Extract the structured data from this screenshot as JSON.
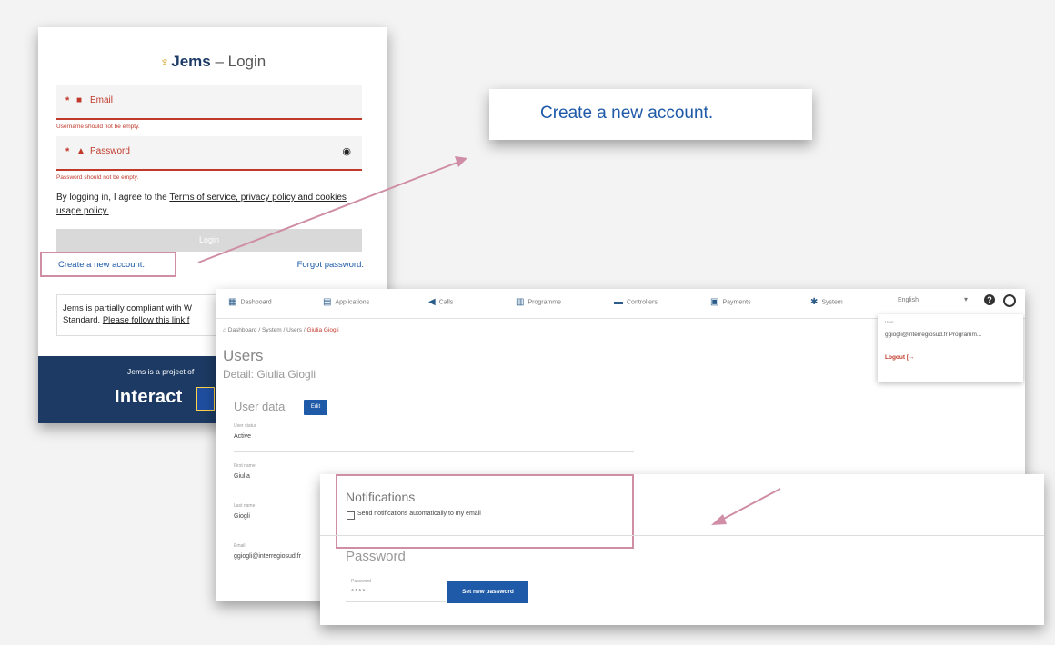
{
  "login": {
    "brand": "Jems",
    "title_suffix": " – Login",
    "email_label": "Email",
    "email_error": "Username should not be empty.",
    "password_label": "Password",
    "password_error": "Password should not be empty.",
    "agree_prefix": "By logging in, I agree to the ",
    "agree_link": "Terms of service, privacy policy and cookies usage policy.",
    "login_button": "Login",
    "create_account": "Create a new account.",
    "forgot_password": "Forgot password.",
    "compliance_line1": "Jems is partially compliant with W",
    "compliance_line2_prefix": "Standard. ",
    "compliance_link": "Please follow this link f",
    "footer_project": "Jems is a project of",
    "footer_brand": "Interact"
  },
  "zoom": {
    "text": "Create a new account."
  },
  "app": {
    "nav": [
      {
        "label": "Dashboard",
        "icon": "dashboard-icon",
        "glyph": "▦"
      },
      {
        "label": "Applications",
        "icon": "document-icon",
        "glyph": "▤"
      },
      {
        "label": "Calls",
        "icon": "megaphone-icon",
        "glyph": "◀"
      },
      {
        "label": "Programme",
        "icon": "programme-icon",
        "glyph": "▥"
      },
      {
        "label": "Controllers",
        "icon": "folder-icon",
        "glyph": "▬"
      },
      {
        "label": "Payments",
        "icon": "payments-icon",
        "glyph": "▣"
      },
      {
        "label": "System",
        "icon": "gear-icon",
        "glyph": "✱"
      }
    ],
    "language": "English",
    "breadcrumb": [
      "Dashboard",
      "System",
      "Users",
      "Giulia Giogli"
    ],
    "page_title": "Users",
    "page_subtitle": "Detail: Giulia Giogli",
    "section_title": "User data",
    "edit_button": "Edit",
    "fields": [
      {
        "label": "User status",
        "value": "Active"
      },
      {
        "label": "First name",
        "value": "Giulia"
      },
      {
        "label": "Last name",
        "value": "Giogli"
      },
      {
        "label": "Email",
        "value": "ggiogli@interregiosud.fr"
      }
    ],
    "menu": {
      "label": "User",
      "email": "ggiogli@interregiosud.fr Programm...",
      "logout": "Logout"
    }
  },
  "notifications": {
    "title": "Notifications",
    "checkbox_label": "Send notifications automatically to my email",
    "password_title": "Password",
    "password_label": "Password",
    "password_value": "****",
    "set_password_button": "Set new password"
  },
  "colors": {
    "accent": "#1e5aa8",
    "error": "#c0392b",
    "highlight": "#cf8ea6",
    "footer": "#1c3a63"
  }
}
